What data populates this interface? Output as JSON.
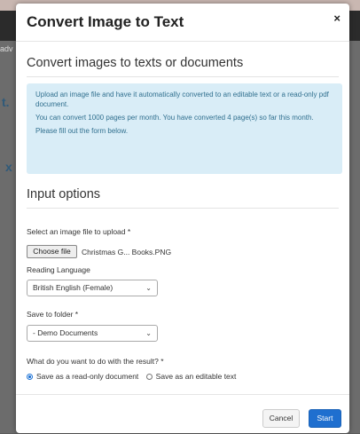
{
  "modal": {
    "title": "Convert Image to Text",
    "close_label": "×",
    "heading": "Convert images to texts or documents",
    "info": {
      "line1": "Upload an image file and have it automatically converted to an editable text or a read-only pdf document.",
      "line2": "You can convert 1000 pages per month. You have converted 4 page(s) so far this month.",
      "line3": "Please fill out the form below."
    },
    "options_heading": "Input options",
    "file": {
      "label": "Select an image file to upload *",
      "button": "Choose file",
      "filename": "Christmas G... Books.PNG"
    },
    "language": {
      "label": "Reading Language",
      "selected": "British English (Female)"
    },
    "folder": {
      "label": "Save to folder *",
      "selected": "- Demo Documents"
    },
    "result": {
      "label": "What do you want to do with the result? *",
      "option1": "Save as a read-only document",
      "option2": "Save as an editable text",
      "selected": "option1"
    },
    "footer": {
      "cancel": "Cancel",
      "start": "Start"
    }
  },
  "background": {
    "fragment_top": "adv",
    "fragment_t": "t.",
    "fragment_x": "x"
  },
  "colors": {
    "info_bg": "#d9edf7",
    "info_text": "#31708f",
    "primary": "#1f6fcf"
  }
}
